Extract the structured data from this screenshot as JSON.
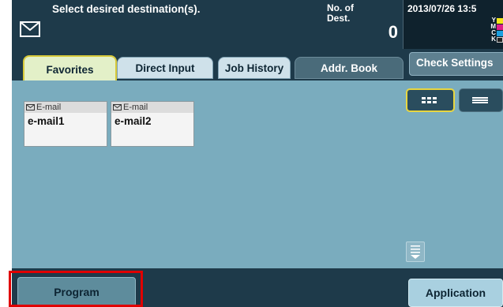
{
  "header": {
    "prompt": "Select desired destination(s).",
    "dest_label_line1": "No. of",
    "dest_label_line2": "Dest.",
    "dest_count": "0",
    "datetime": "2013/07/26 13:5",
    "toner_levels": [
      {
        "label": "Y",
        "color": "#f5e61a"
      },
      {
        "label": "M",
        "color": "#e0208a"
      },
      {
        "label": "C",
        "color": "#1aa0e0"
      },
      {
        "label": "K",
        "color": "#222222"
      }
    ]
  },
  "tabs": [
    {
      "label": "Favorites",
      "active": true
    },
    {
      "label": "Direct Input",
      "active": false
    },
    {
      "label": "Job History",
      "active": false
    },
    {
      "label": "Addr. Book",
      "active": false
    }
  ],
  "check_settings_label": "Check Settings",
  "destinations": [
    {
      "type": "E-mail",
      "name": "e-mail1",
      "icon": "envelope-icon"
    },
    {
      "type": "E-mail",
      "name": "e-mail2",
      "icon": "envelope-icon"
    }
  ],
  "view_modes": {
    "selected": "grid",
    "options": [
      "grid",
      "list"
    ]
  },
  "footer": {
    "program_label": "Program",
    "application_label": "Application"
  },
  "colors": {
    "header_bg": "#1e3a4a",
    "content_bg": "#7aacbe",
    "highlight": "#e00000",
    "active_tab_border": "#d7c93a"
  }
}
